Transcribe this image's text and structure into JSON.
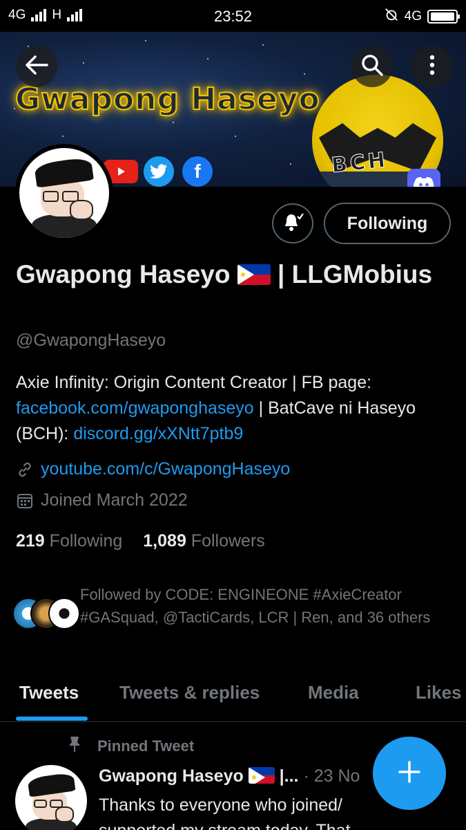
{
  "statusbar": {
    "net1": "4G",
    "net2": "H",
    "time": "23:52",
    "net3": "4G"
  },
  "banner": {
    "title": "Gwapong Haseyo",
    "logo_text": "BCH",
    "social_icons": [
      "youtube-icon",
      "twitter-icon",
      "facebook-icon",
      "discord-icon"
    ]
  },
  "profile": {
    "name": "Gwapong Haseyo 🇵🇭 | LLGMobius",
    "name_part1": "Gwapong Haseyo",
    "name_part2": "| LLGMobius",
    "handle": "@GwapongHaseyo",
    "bio_text1": "Axie Infinity: Origin Content Creator | FB page:",
    "bio_link1": "facebook.com/gwaponghaseyo",
    "bio_text2": "| BatCave ni Haseyo (BCH):",
    "bio_link2": "discord.gg/xXNtt7ptb9",
    "website": "youtube.com/c/GwapongHaseyo",
    "joined": "Joined March 2022",
    "following_count": "219",
    "following_label": "Following",
    "followers_count": "1,089",
    "followers_label": "Followers",
    "followed_by": "Followed by CODE: ENGINEONE #AxieCreator #GASquad, @TactiCards, LCR | Ren, and 36 others"
  },
  "actions": {
    "following_button": "Following"
  },
  "tabs": [
    "Tweets",
    "Tweets & replies",
    "Media",
    "Likes"
  ],
  "pinned_tweet": {
    "pinned_label": "Pinned Tweet",
    "author": "Gwapong Haseyo",
    "author_suffix": "|...",
    "date": "· 23 No",
    "text": "Thanks to everyone who joined/ supported my stream today. That"
  },
  "colors": {
    "accent": "#1d9bf0",
    "background": "#000000",
    "muted": "#71767b"
  }
}
